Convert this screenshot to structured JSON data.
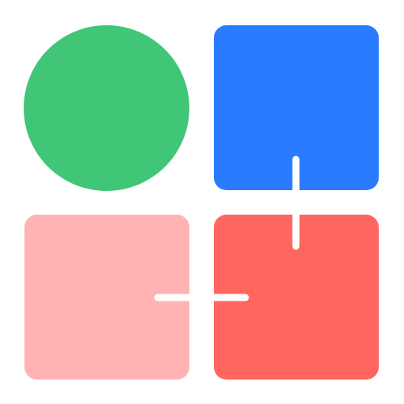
{
  "logo": {
    "icon_name": "four-shapes-grid-logo",
    "shapes": [
      {
        "name": "green-circle",
        "shape": "circle",
        "color": "#41C677"
      },
      {
        "name": "blue-rounded-square",
        "shape": "rounded-square-with-notch",
        "color": "#2A7BFF"
      },
      {
        "name": "pink-rounded-square",
        "shape": "rounded-square-with-notch",
        "color": "#FFB3B3"
      },
      {
        "name": "red-rounded-square",
        "shape": "rounded-square-with-notches",
        "color": "#FF6660"
      }
    ],
    "background": "#FFFFFF"
  }
}
